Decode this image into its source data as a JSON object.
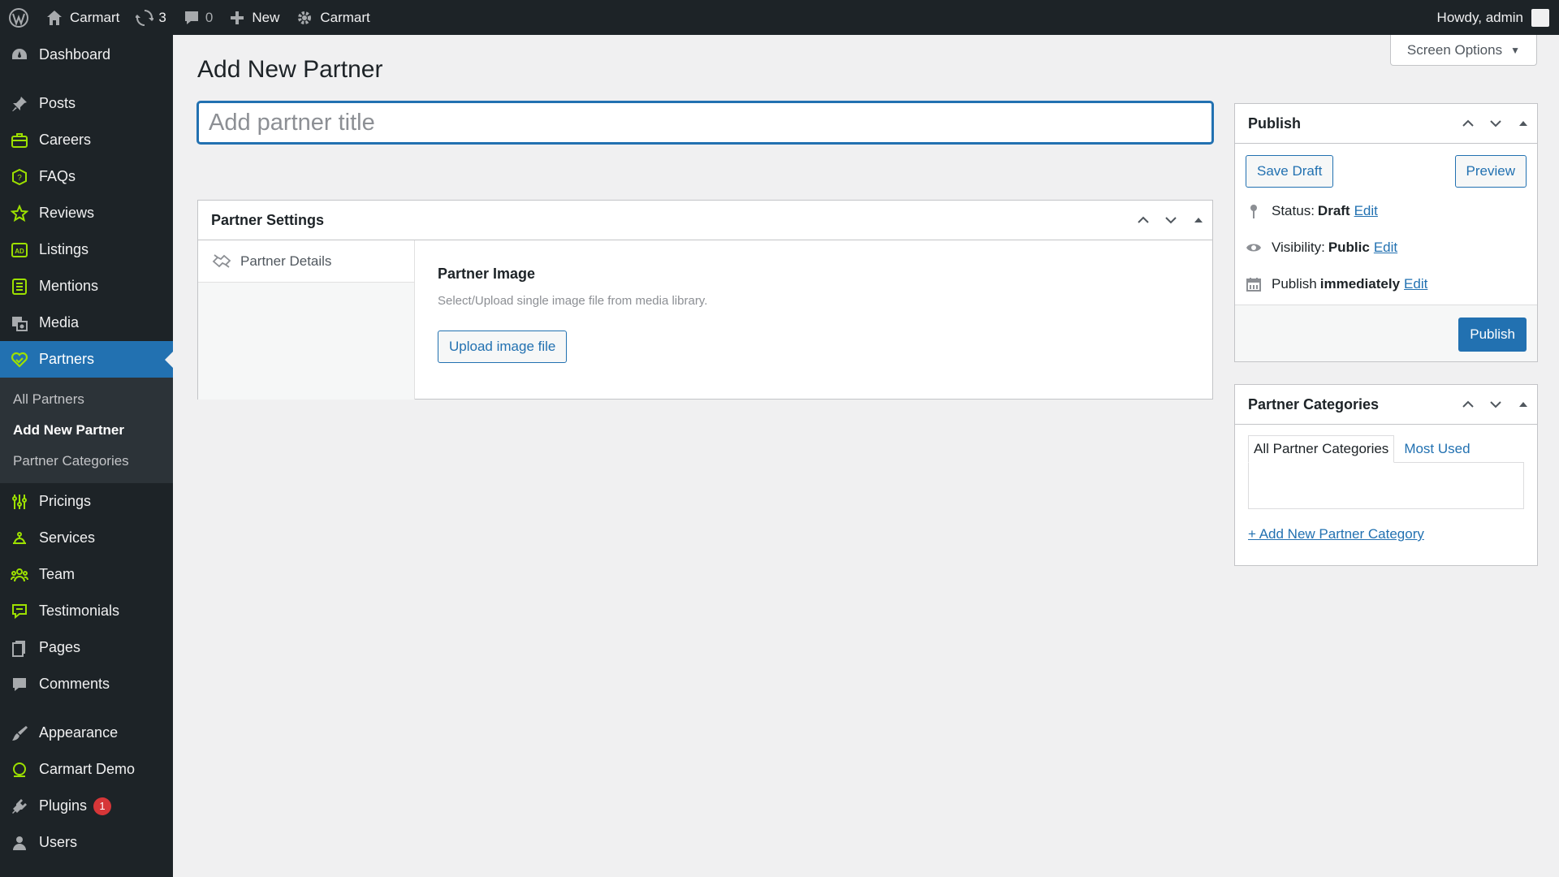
{
  "adminbar": {
    "site_name": "Carmart",
    "updates_count": "3",
    "comments_count": "0",
    "new_label": "New",
    "plugin_label": "Carmart",
    "howdy": "Howdy, admin"
  },
  "sidebar": {
    "items": [
      {
        "label": "Dashboard",
        "icon": "dashboard-icon"
      },
      {
        "label": "Posts",
        "icon": "pin-icon"
      },
      {
        "label": "Careers",
        "icon": "briefcase-icon"
      },
      {
        "label": "FAQs",
        "icon": "question-icon"
      },
      {
        "label": "Reviews",
        "icon": "star-icon"
      },
      {
        "label": "Listings",
        "icon": "ad-icon"
      },
      {
        "label": "Mentions",
        "icon": "list-icon"
      },
      {
        "label": "Media",
        "icon": "media-icon"
      },
      {
        "label": "Partners",
        "icon": "handshake-icon"
      },
      {
        "label": "Pricings",
        "icon": "sliders-icon"
      },
      {
        "label": "Services",
        "icon": "service-icon"
      },
      {
        "label": "Team",
        "icon": "team-icon"
      },
      {
        "label": "Testimonials",
        "icon": "testimonial-icon"
      },
      {
        "label": "Pages",
        "icon": "pages-icon"
      },
      {
        "label": "Comments",
        "icon": "comment-icon"
      },
      {
        "label": "Appearance",
        "icon": "brush-icon"
      },
      {
        "label": "Carmart Demo",
        "icon": "lifebuoy-icon"
      },
      {
        "label": "Plugins",
        "icon": "plugin-icon",
        "badge": "1"
      },
      {
        "label": "Users",
        "icon": "user-icon"
      }
    ],
    "submenu": [
      "All Partners",
      "Add New Partner",
      "Partner Categories"
    ]
  },
  "screen_options": "Screen Options",
  "page_title": "Add New Partner",
  "title_placeholder": "Add partner title",
  "partner_settings": {
    "heading": "Partner Settings",
    "tab_label": "Partner Details",
    "field_title": "Partner Image",
    "field_desc": "Select/Upload single image file from media library.",
    "upload_label": "Upload image file"
  },
  "publish": {
    "heading": "Publish",
    "save_draft": "Save Draft",
    "preview": "Preview",
    "status_label": "Status:",
    "status_value": "Draft",
    "visibility_label": "Visibility:",
    "visibility_value": "Public",
    "publish_label": "Publish",
    "publish_value": "immediately",
    "edit": "Edit",
    "publish_button": "Publish"
  },
  "categories": {
    "heading": "Partner Categories",
    "tab_all": "All Partner Categories",
    "tab_most_used": "Most Used",
    "add_new": "+ Add New Partner Category"
  },
  "colors": {
    "accent": "#2271b1",
    "sidebar_bg": "#1d2327",
    "icon_green": "#9de000",
    "badge": "#d63638"
  }
}
